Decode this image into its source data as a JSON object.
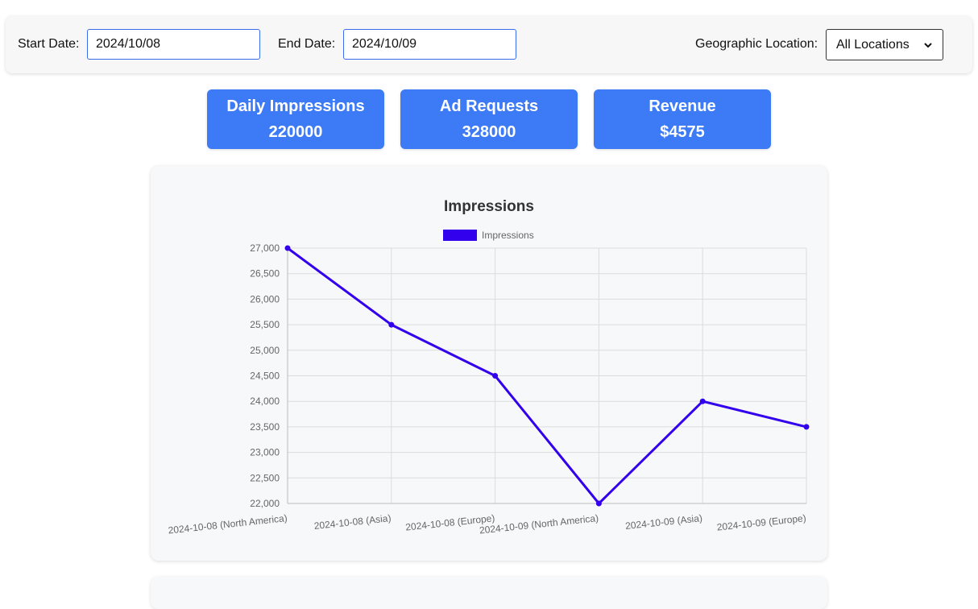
{
  "filters": {
    "start_label": "Start Date:",
    "start_value": "2024/10/08",
    "end_label": "End Date:",
    "end_value": "2024/10/09",
    "location_label": "Geographic Location:",
    "location_selected": "All Locations"
  },
  "kpis": [
    {
      "title": "Daily Impressions",
      "value": "220000"
    },
    {
      "title": "Ad Requests",
      "value": "328000"
    },
    {
      "title": "Revenue",
      "value": "$4575"
    }
  ],
  "colors": {
    "accent": "#3d7bf6",
    "series": "#3300ee"
  },
  "chart_data": {
    "type": "line",
    "title": "Impressions",
    "categories": [
      "2024-10-08 (North America)",
      "2024-10-08 (Asia)",
      "2024-10-08 (Europe)",
      "2024-10-09 (North America)",
      "2024-10-09 (Asia)",
      "2024-10-09 (Europe)"
    ],
    "series": [
      {
        "name": "Impressions",
        "values": [
          27000,
          25500,
          24500,
          22000,
          24000,
          23500
        ]
      }
    ],
    "ylim": [
      22000,
      27000
    ],
    "yticks": [
      "27,000",
      "26,500",
      "26,000",
      "25,500",
      "25,000",
      "24,500",
      "24,000",
      "23,500",
      "23,000",
      "22,500",
      "22,000"
    ],
    "grid": true,
    "legend": "top"
  }
}
